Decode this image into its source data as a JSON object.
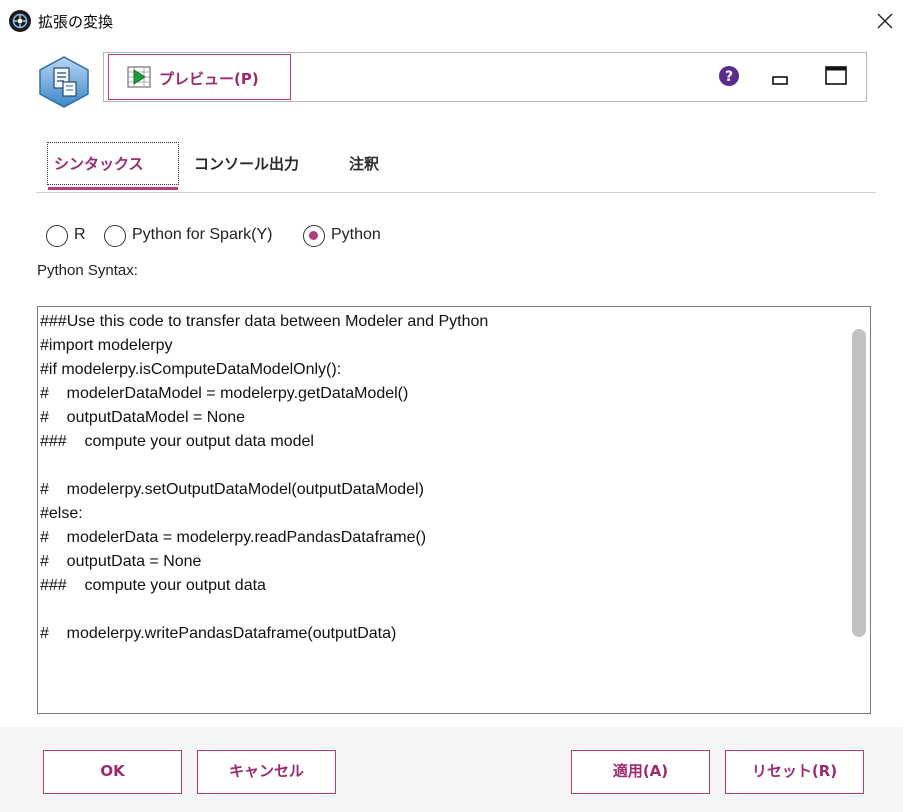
{
  "window": {
    "title": "拡張の変換",
    "app_icon": "spss-modeler-icon",
    "close_icon": "close-icon"
  },
  "toolbar": {
    "node_icon": "extension-transform-node-icon",
    "preview_label": "プレビュー(P)",
    "preview_icon": "preview-play-icon",
    "help_icon": "help-icon",
    "minimize_icon": "minimize-icon",
    "maximize_icon": "maximize-icon"
  },
  "tabs": [
    {
      "label": "シンタックス",
      "active": true
    },
    {
      "label": "コンソール出力",
      "active": false
    },
    {
      "label": "注釈",
      "active": false
    }
  ],
  "language_options": [
    {
      "label": "R",
      "checked": false
    },
    {
      "label": "Python for Spark(Y)",
      "checked": false
    },
    {
      "label": "Python",
      "checked": true
    }
  ],
  "syntax_label": "Python Syntax:",
  "code_lines": [
    "###Use this code to transfer data between Modeler and Python",
    "#import modelerpy",
    "#if modelerpy.isComputeDataModelOnly():",
    "#    modelerDataModel = modelerpy.getDataModel()",
    "#    outputDataModel = None",
    "###    compute your output data model",
    "",
    "#    modelerpy.setOutputDataModel(outputDataModel)",
    "#else:",
    "#    modelerData = modelerpy.readPandasDataframe()",
    "#    outputData = None",
    "###    compute your output data",
    "",
    "#    modelerpy.writePandasDataframe(outputData)"
  ],
  "buttons": {
    "ok": "OK",
    "cancel": "キャンセル",
    "apply": "適用(A)",
    "reset": "リセット(R)"
  },
  "colors": {
    "accent": "#b23c84",
    "accent_text": "#9b2b6e",
    "footer_bg": "#f5f5f5"
  }
}
